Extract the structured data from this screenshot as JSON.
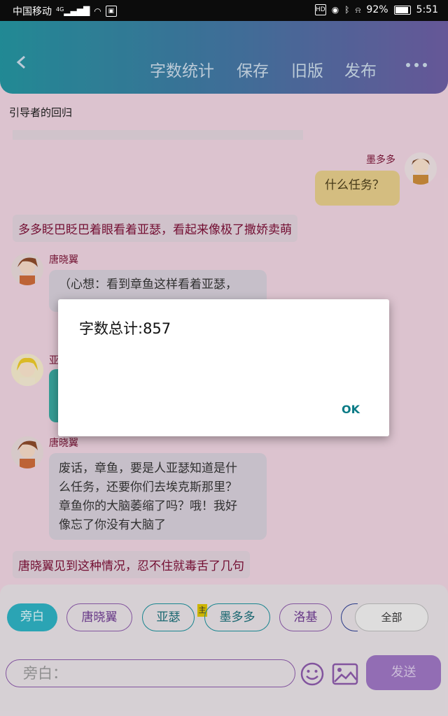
{
  "status_bar": {
    "carrier": "中国移动",
    "signal": "4G",
    "battery": "92%",
    "time": "5:51"
  },
  "header": {
    "menu": [
      "字数统计",
      "保存",
      "旧版",
      "发布"
    ]
  },
  "story": {
    "title": "引导者的回归"
  },
  "messages": [
    {
      "speaker": "墨多多",
      "text": "什么任务？"
    },
    {
      "narration": "多多眨巴眨巴着眼看着亚瑟，看起来像极了撒娇卖萌"
    },
    {
      "speaker": "唐晓翼",
      "text": "（心想：看到章鱼这样看着亚瑟，"
    },
    {
      "speaker": "亚",
      "text": ""
    },
    {
      "speaker": "唐晓翼",
      "text_lines": [
        "废话，章鱼，要是人亚瑟知道是什",
        "么任务，还要你们去埃克斯那里？",
        "章鱼你的大脑萎缩了吗？哦！我好",
        "像忘了你没有大脑了"
      ]
    },
    {
      "narration": "唐晓翼见到这种情况，忍不住就毒舌了几句"
    }
  ],
  "dialog": {
    "message": "字数总计:857",
    "ok": "OK"
  },
  "characters": {
    "items": [
      "旁白",
      "唐晓翼",
      "亚瑟",
      "墨多多",
      "洛基"
    ],
    "badge": "主",
    "all": "全部"
  },
  "composer": {
    "placeholder": "旁白：",
    "send": "发送"
  }
}
